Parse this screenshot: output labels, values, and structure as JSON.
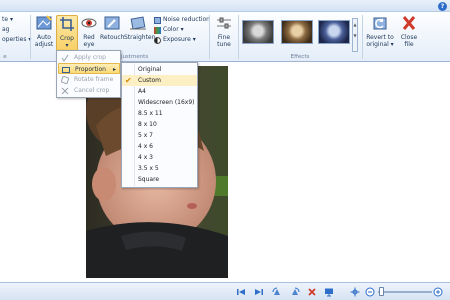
{
  "help": "?",
  "left_items": [
    "te",
    "ag",
    "operties"
  ],
  "ribbon": {
    "auto_adjust": [
      "Auto",
      "adjust"
    ],
    "crop": "Crop",
    "red_eye": [
      "Red",
      "eye"
    ],
    "retouch": "Retouch",
    "straighten": "Straighten",
    "noise_reduction": "Noise reduction",
    "color": "Color",
    "exposure": "Exposure",
    "fine_tune": [
      "Fine",
      "tune"
    ],
    "revert": [
      "Revert to",
      "original"
    ],
    "close": [
      "Close",
      "file"
    ],
    "group_left": "e",
    "group_adjustments": "Adjustments",
    "group_effects": "Effects"
  },
  "crop_menu": {
    "apply": "Apply crop",
    "proportion": "Proportion",
    "rotate": "Rotate frame",
    "cancel": "Cancel crop"
  },
  "proportion_menu": {
    "items": [
      "Original",
      "Custom",
      "A4",
      "Widescreen (16x9)",
      "8.5 x 11",
      "8 x 10",
      "5 x 7",
      "4 x 6",
      "4 x 3",
      "3.5 x 5",
      "Square"
    ],
    "checked": "Custom"
  },
  "colors": {
    "accent_orange": "#d38a00",
    "close_red": "#d03a2a",
    "brand_blue": "#1e395b"
  }
}
